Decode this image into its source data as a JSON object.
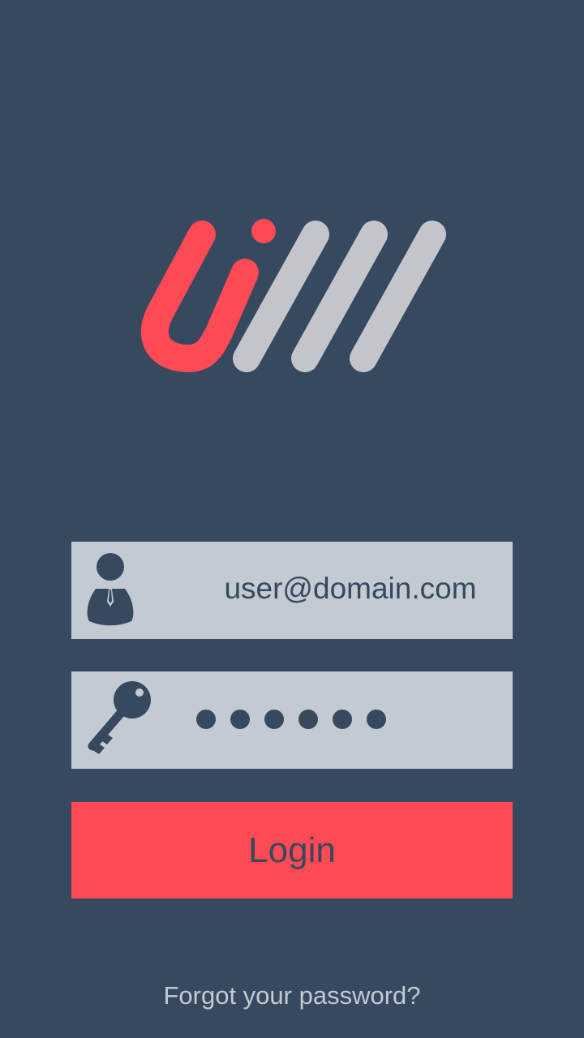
{
  "logo": {
    "icon": "ui-logo-icon",
    "colors": {
      "accent": "#ff4a55",
      "stripes": "#c3c5ca"
    }
  },
  "form": {
    "email": {
      "icon": "user-icon",
      "value": "user@domain.com"
    },
    "password": {
      "icon": "key-icon",
      "masked_value": "●●●●●●",
      "length": 6
    },
    "login_label": "Login",
    "forgot_label": "Forgot your password?"
  },
  "colors": {
    "background": "#36495f",
    "field": "#c3cad2",
    "accent": "#ff4a55",
    "text_dark": "#36495f",
    "text_light": "#c3cad2"
  }
}
